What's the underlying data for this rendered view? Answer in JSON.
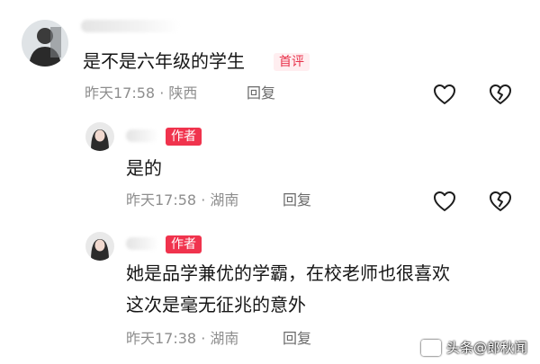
{
  "comments": [
    {
      "text_lines": [
        "是不是六年级的学生"
      ],
      "tag": "首评",
      "time": "昨天17:58",
      "location": "陕西",
      "reply_label": "回复"
    },
    {
      "text_lines": [
        "是的"
      ],
      "tag": "作者",
      "time": "昨天17:58",
      "location": "湖南",
      "reply_label": "回复"
    },
    {
      "text_lines": [
        "她是品学兼优的学霸，在校老师也很喜欢",
        "这次是毫无征兆的意外"
      ],
      "tag": "作者",
      "time": "昨天17:38",
      "location": "湖南",
      "reply_label": "回复"
    }
  ],
  "meta_separator": " · ",
  "watermark": "头条@郎秋闻",
  "colors": {
    "accent": "#f0334d",
    "meta": "#8e8e8e"
  },
  "icons": [
    "like-icon",
    "dislike-icon"
  ]
}
